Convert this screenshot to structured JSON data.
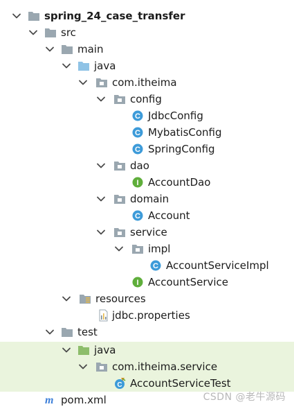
{
  "tree": {
    "project": "spring_24_case_transfer",
    "src": "src",
    "main": "main",
    "main_java": "java",
    "pkg": "com.itheima",
    "config": "config",
    "jdbc_config": "JdbcConfig",
    "mybatis_config": "MybatisConfig",
    "spring_config": "SpringConfig",
    "dao": "dao",
    "account_dao": "AccountDao",
    "domain": "domain",
    "account": "Account",
    "service": "service",
    "impl": "impl",
    "account_service_impl": "AccountServiceImpl",
    "account_service": "AccountService",
    "resources": "resources",
    "jdbc_properties": "jdbc.properties",
    "test": "test",
    "test_java": "java",
    "test_pkg": "com.itheima.service",
    "account_service_test": "AccountServiceTest",
    "pom": "pom.xml"
  },
  "watermark": "CSDN @老牛源码",
  "colors": {
    "folder": "#9aa7b0",
    "source_folder": "#8fc3e6",
    "test_folder": "#8dbd6b",
    "class_icon": "#3d9bd9",
    "interface_icon": "#5fae3b",
    "test_row_bg": "#eaf4dd"
  }
}
